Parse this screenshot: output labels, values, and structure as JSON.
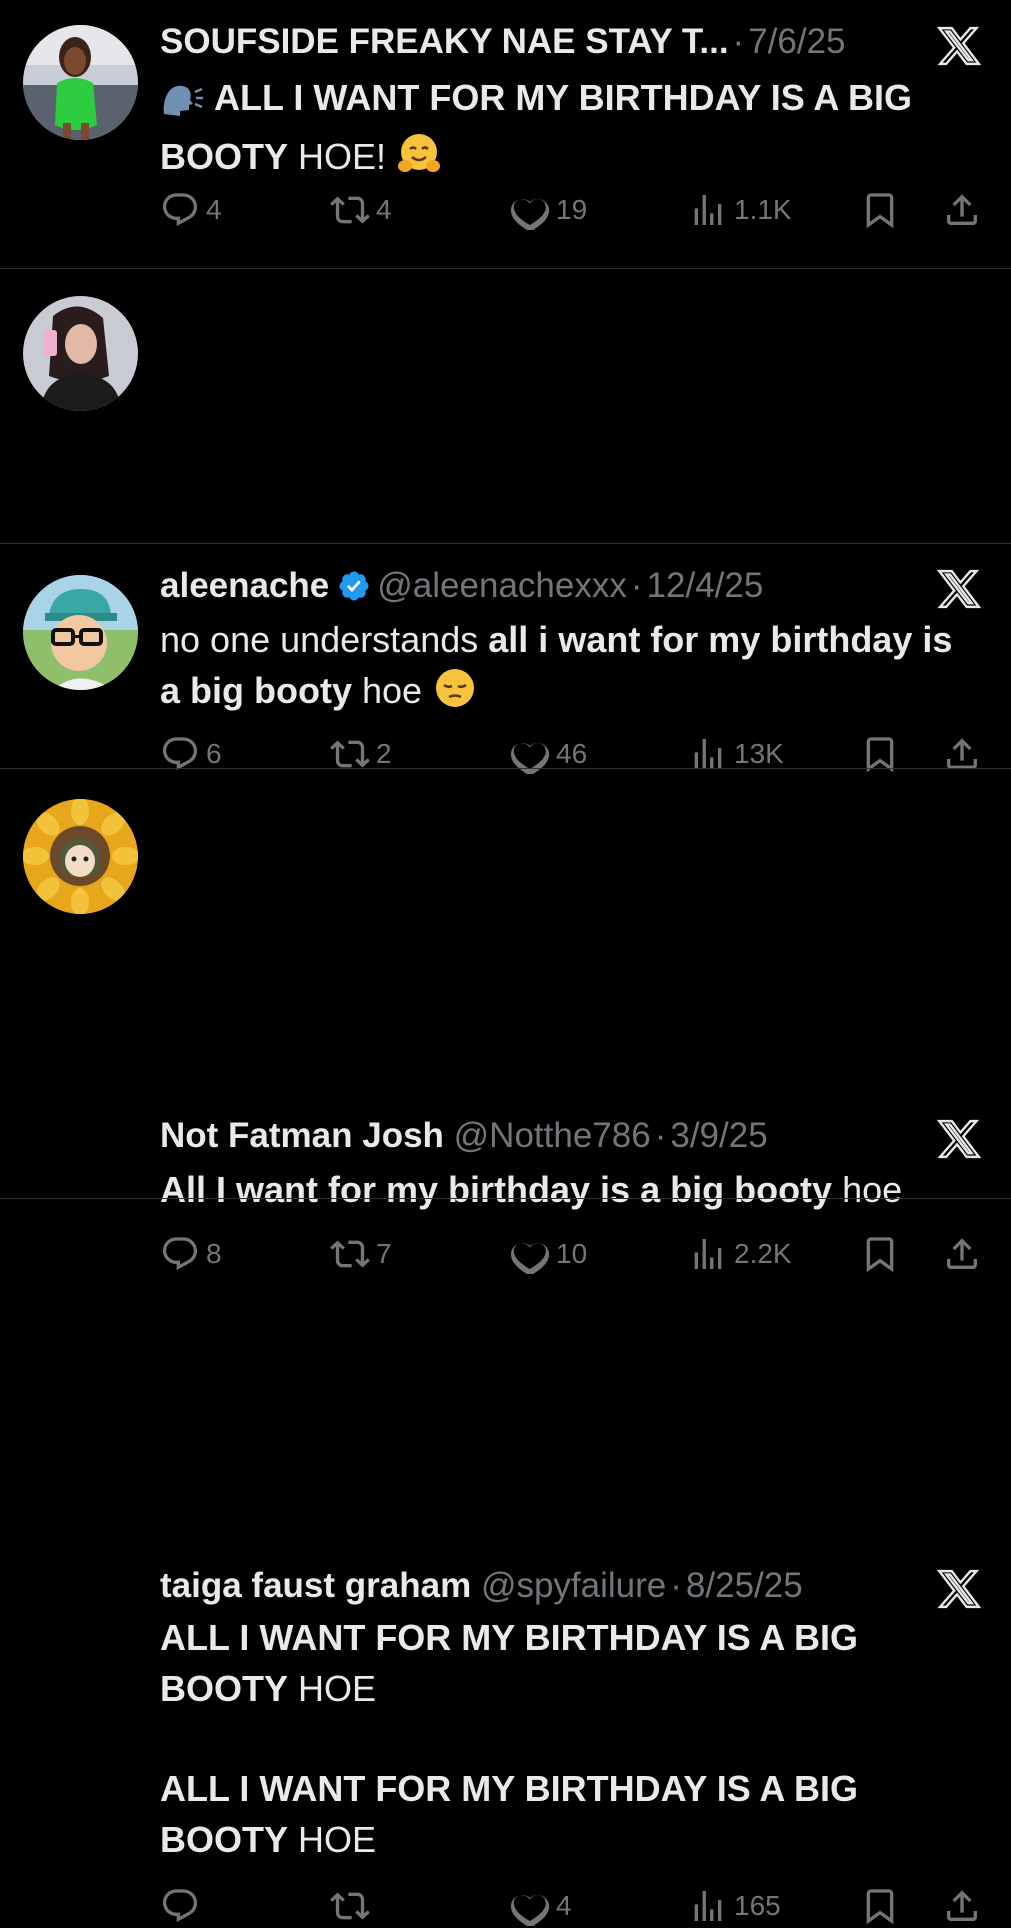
{
  "tweets": [
    {
      "name": "SOUFSIDE FREAKY NAE STAY T...",
      "handle": "",
      "date": "7/6/25",
      "verified": false,
      "body_bold": "ALL I WANT FOR MY BIRTHDAY IS A BIG BOOTY",
      "body_normal": "HOE!",
      "lead_emoji": "speaking-head-emoji",
      "trail_emoji": "hugging-face-emoji",
      "replies": "4",
      "retweets": "4",
      "likes": "19",
      "views": "1.1K",
      "avatar": "profile-photo-green-dress"
    },
    {
      "name": "aleenache",
      "handle": "@aleenachexxx",
      "date": "12/4/25",
      "verified": true,
      "body_normal1": "no one understands",
      "body_bold": "all i want for my birthday is a big booty",
      "body_normal2": "hoe",
      "trail_emoji": "pensive-face-emoji",
      "replies": "6",
      "retweets": "2",
      "likes": "46",
      "views": "13K",
      "avatar": "profile-photo-selfie"
    },
    {
      "name": "Not Fatman Josh",
      "handle": "@Notthe786",
      "date": "3/9/25",
      "verified": false,
      "body_bold": "All I want for my birthday is a big booty",
      "body_normal": "hoe",
      "replies": "8",
      "retweets": "7",
      "likes": "10",
      "views": "2.2K",
      "avatar": "cartoon-hank-hill"
    },
    {
      "name": "taiga faust graham",
      "handle": "@spyfailure",
      "date": "8/25/25",
      "verified": false,
      "para1_bold": "ALL I WANT FOR MY BIRTHDAY IS A BIG BOOTY",
      "para1_normal": "HOE",
      "para2_bold": "ALL I WANT FOR MY BIRTHDAY IS A BIG BOOTY",
      "para2_normal": "HOE",
      "replies": "",
      "retweets": "",
      "likes": "4",
      "views": "165",
      "avatar": "sunflower-character"
    }
  ],
  "colors": {
    "background": "#000000",
    "text": "#e7e9ea",
    "muted": "#71767b",
    "verified": "#1d9bf0",
    "divider": "#2f3336"
  },
  "icons": [
    "reply-icon",
    "retweet-icon",
    "heart-icon",
    "views-icon",
    "bookmark-icon",
    "share-icon",
    "x-logo-icon",
    "verified-badge-icon"
  ]
}
